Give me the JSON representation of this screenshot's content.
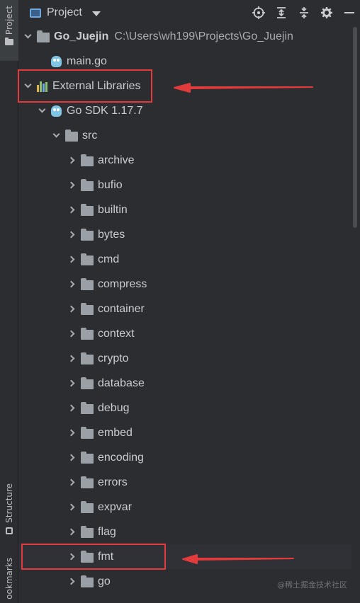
{
  "tool_strip": {
    "project_tab": "Project",
    "structure_tab": "Structure",
    "bookmarks_tab": "ookmarks"
  },
  "header": {
    "title": "Project",
    "icons": [
      "locate-icon",
      "expand-all-icon",
      "collapse-all-icon",
      "gear-icon",
      "hide-icon"
    ]
  },
  "tree": {
    "root": {
      "name": "Go_Juejin",
      "path": "C:\\Users\\wh199\\Projects\\Go_Juejin"
    },
    "main_file": "main.go",
    "external_libraries": "External Libraries",
    "sdk": "Go SDK 1.17.7",
    "src": "src",
    "packages": [
      "archive",
      "bufio",
      "builtin",
      "bytes",
      "cmd",
      "compress",
      "container",
      "context",
      "crypto",
      "database",
      "debug",
      "embed",
      "encoding",
      "errors",
      "expvar",
      "flag",
      "fmt",
      "go"
    ]
  },
  "watermark": "@稀土掘金技术社区",
  "colors": {
    "annotation": "#e33b3b",
    "background": "#2b2d30",
    "text": "#c9ccd1"
  }
}
